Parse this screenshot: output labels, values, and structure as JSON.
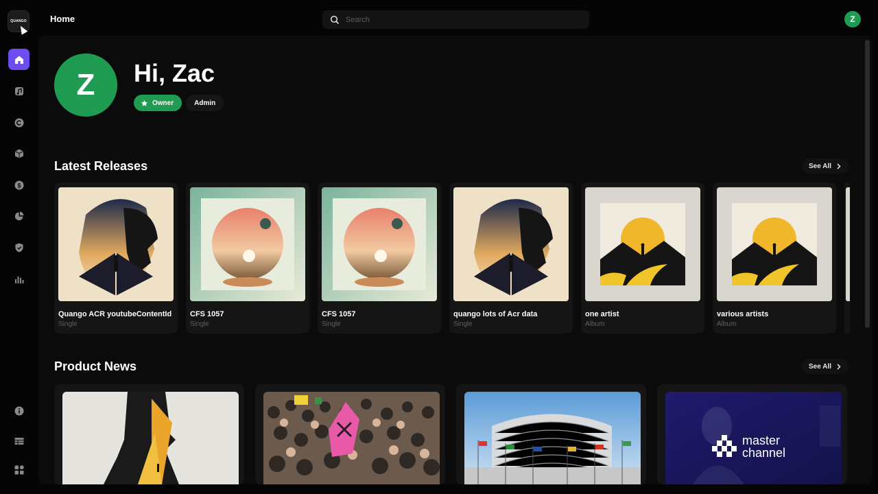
{
  "app": {
    "logo_text": "QUANGO",
    "page_title": "Home"
  },
  "search": {
    "placeholder": "Search"
  },
  "user": {
    "initial": "Z"
  },
  "profile": {
    "initial": "Z",
    "greeting": "Hi, Zac",
    "roles": [
      "Owner",
      "Admin"
    ]
  },
  "sidebar": {
    "top_items": [
      "home-icon",
      "music-note-icon",
      "copyright-icon",
      "cube-icon",
      "dollar-icon",
      "pie-chart-icon",
      "shield-icon",
      "bar-chart-icon"
    ],
    "bottom_items": [
      "info-icon",
      "table-icon",
      "apps-icon"
    ]
  },
  "latest_releases": {
    "title": "Latest Releases",
    "see_all": "See All",
    "items": [
      {
        "title": "Quango ACR youtubeContentId",
        "type": "Single",
        "art": "silhouette-sunset"
      },
      {
        "title": "CFS 1057",
        "type": "Single",
        "art": "sphere-landscape"
      },
      {
        "title": "CFS 1057",
        "type": "Single",
        "art": "sphere-landscape"
      },
      {
        "title": "quango lots of Acr data",
        "type": "Single",
        "art": "silhouette-sunset"
      },
      {
        "title": "one artist",
        "type": "Album",
        "art": "yellow-sun-mountains"
      },
      {
        "title": "various artists",
        "type": "Album",
        "art": "yellow-sun-mountains"
      }
    ]
  },
  "product_news": {
    "title": "Product News",
    "see_all": "See All",
    "items": [
      {
        "art": "silhouette-profile"
      },
      {
        "art": "protest-crowd"
      },
      {
        "art": "un-building-flags"
      },
      {
        "art": "master-channel",
        "logo_text": "master channel"
      }
    ]
  },
  "colors": {
    "accent_purple": "#6d4df2",
    "accent_green": "#1f9b52",
    "background": "#050505",
    "panel": "#0b0b0b",
    "card": "#151515"
  }
}
